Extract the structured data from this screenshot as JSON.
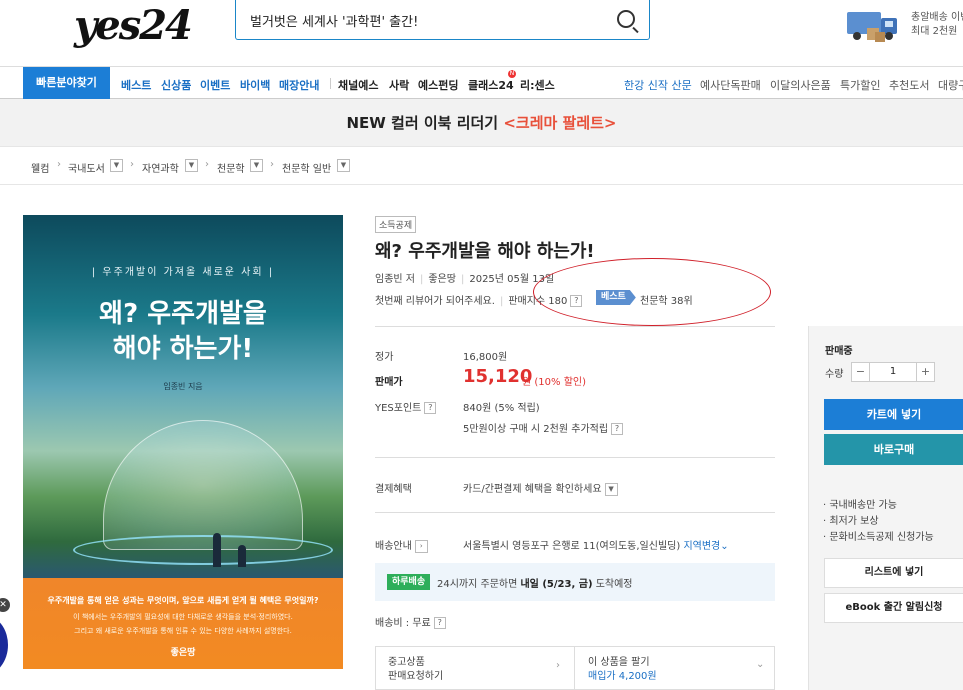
{
  "header": {
    "logo": "yes24",
    "search_text": "벌거벗은 세계사 '과학편' 출간!",
    "promo_line1": "총알배송 이벤",
    "promo_line2": "최대 2천원"
  },
  "nav": {
    "quick": "빠른분야찾기",
    "blue_items": [
      "베스트",
      "신상품",
      "이벤트",
      "바이백",
      "매장안내"
    ],
    "dark_items": [
      "채널예스",
      "사락",
      "예스펀딩",
      "클래스24",
      "리:센스"
    ],
    "new_badge": "N",
    "right_items": [
      "한강 신작 산문",
      "예사단독판매",
      "이달의사은품",
      "특가할인",
      "추천도서",
      "대량구"
    ]
  },
  "banner": {
    "prefix": "NEW 컬러 이북 리더기 ",
    "accent": "<크레마 팔레트>"
  },
  "breadcrumb": [
    "웰컴",
    "국내도서",
    "자연과학",
    "천문학",
    "천문학 일반"
  ],
  "cover": {
    "tagline": "| 우주개발이 가져올 새로운 사회 |",
    "title_line1": "왜? 우주개발을",
    "title_line2": "해야 하는가!",
    "author": "임종빈 지음",
    "bottom_line1": "우주개발을 통해 얻은 성과는 무엇이며, 앞으로 새롭게 얻게 될 혜택은 무엇일까?",
    "bottom_line2": "이 책에서는 우주개발의 필요성에 대한 다채로운 생각들을 분석·정리하였다.",
    "bottom_line3": "그리고 왜 새로운 우주개발을 통해 인류 수 있는 다양한 사례까지 설명한다.",
    "publisher": "좋은땅"
  },
  "product": {
    "tag": "소득공제",
    "title": "왜? 우주개발을 해야 하는가!",
    "author": "임종빈 저",
    "publisher": "좋은땅",
    "date": "2025년 05월 13일",
    "review": "첫번째 리뷰어가 되어주세요.",
    "sales_index": "판매지수 180",
    "best_badge": "베스트",
    "rank": "천문학 38위"
  },
  "price": {
    "list_label": "정가",
    "list_value": "16,800원",
    "sale_label": "판매가",
    "sale_value": "15,120",
    "sale_unit": "원",
    "discount": "(10% 할인)",
    "point_label": "YES포인트",
    "point_value": "840원 (5% 적립)",
    "point_extra": "5만원이상 구매 시 2천원 추가적립"
  },
  "payment": {
    "label": "결제혜택",
    "value": "카드/간편결제 혜택을 확인하세요"
  },
  "shipping": {
    "label": "배송안내",
    "address": "서울특별시 영등포구 은행로 11(여의도동,일신빌딩)",
    "change": "지역변경",
    "today_badge": "하루배송",
    "delivery_pre": "24시까지 주문하면 ",
    "delivery_bold": "내일 (5/23, 금)",
    "delivery_post": " 도착예정",
    "fee": "배송비 : 무료"
  },
  "bottom": {
    "used_line1": "중고상품",
    "used_line2": "판매요청하기",
    "sell_line1": "이 상품을 팔기",
    "sell_line2": "매입가 4,200원"
  },
  "right_panel": {
    "status": "판매중",
    "qty_label": "수량",
    "qty_value": "1",
    "cart": "카트에 넣기",
    "buy": "바로구매",
    "bullets": [
      "국내배송만 가능",
      "최저가 보상",
      "문화비소득공제 신청가능"
    ],
    "wishlist": "리스트에 넣기",
    "ebook": "eBook 출간 알림신청"
  },
  "colors": {
    "accent_blue": "#1c7ed6",
    "teal": "#2495a9",
    "price_red": "#e0312f",
    "annotation_red": "#d0202a"
  }
}
